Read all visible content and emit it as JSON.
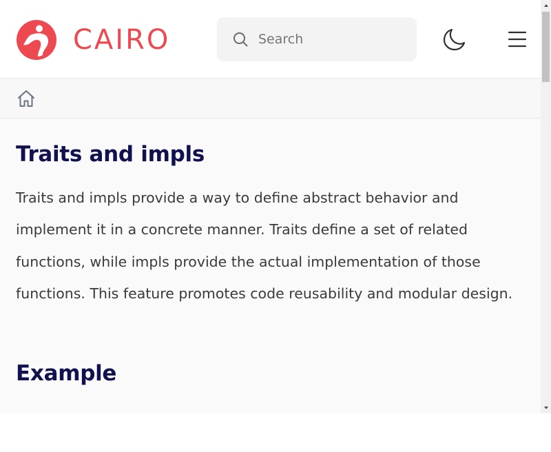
{
  "header": {
    "brand": "CAIRO",
    "brand_color": "#ec4a50",
    "search": {
      "placeholder": "Search",
      "value": ""
    },
    "theme_toggle_icon": "moon-icon",
    "menu_icon": "hamburger-menu-icon"
  },
  "breadcrumb": {
    "home_icon": "home-icon"
  },
  "main": {
    "title": "Traits and impls",
    "intro": "Traits and impls provide a way to define abstract behavior and implement it in a concrete manner. Traits define a set of related functions, while impls provide the actual implementation of those functions. This feature promotes code reusability and modular design.",
    "section_heading": "Example"
  },
  "colors": {
    "heading": "#11114f",
    "body_text": "#3a3a3a",
    "page_background": "#fafafa"
  }
}
